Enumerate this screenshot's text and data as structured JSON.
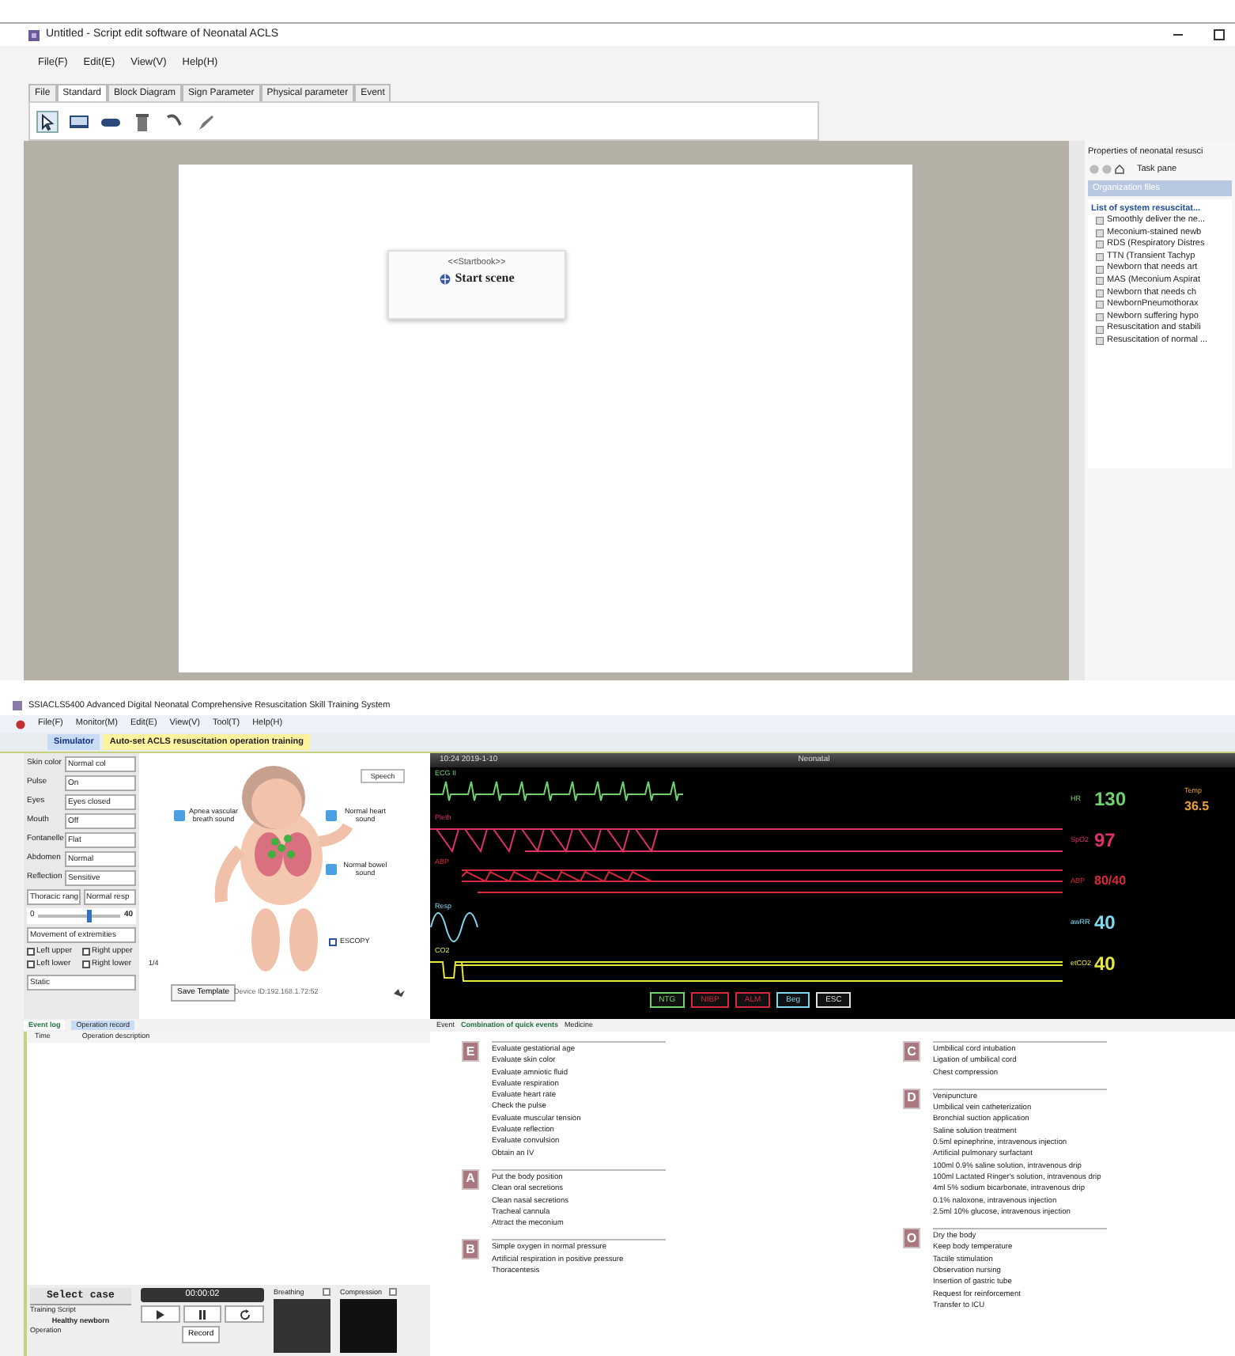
{
  "editor": {
    "title": "Untitled - Script edit software of Neonatal ACLS",
    "menu": [
      "File(F)",
      "Edit(E)",
      "View(V)",
      "Help(H)"
    ],
    "tabs": [
      {
        "label": "File",
        "selected": false
      },
      {
        "label": "Standard",
        "selected": true
      },
      {
        "label": "Block Diagram",
        "selected": false
      },
      {
        "label": "Sign Parameter",
        "selected": false
      },
      {
        "label": "Physical parameter",
        "selected": false
      },
      {
        "label": "Event",
        "selected": false
      }
    ],
    "start_node": {
      "stereotype": "<<Startbook>>",
      "label": "Start scene"
    },
    "properties": {
      "title": "Properties of neonatal resusci",
      "pane": "Task pane",
      "header": "Organization files",
      "root": "List of system resuscitat...",
      "items": [
        "Smoothly deliver the ne...",
        "Meconium-stained newb",
        "RDS (Respiratory Distres",
        "TTN (Transient Tachyp",
        "Newborn that needs art",
        "MAS (Meconium Aspirat",
        "Newborn that needs ch",
        "NewbornPneumothorax",
        "Newborn suffering hypo",
        "Resuscitation and stabili",
        "Resuscitation of normal ..."
      ]
    }
  },
  "trainer": {
    "title": "SSIACLS5400 Advanced Digital Neonatal Comprehensive Resuscitation Skill Training System",
    "menu": [
      "File(F)",
      "Monitor(M)",
      "Edit(E)",
      "View(V)",
      "Tool(T)",
      "Help(H)"
    ],
    "tabs": [
      {
        "label": "Simulator",
        "selected": true
      },
      {
        "label": "Auto-set ACLS resuscitation operation training",
        "selected": false
      }
    ],
    "params": [
      {
        "label": "Skin color",
        "value": "Normal col"
      },
      {
        "label": "Pulse",
        "value": "On"
      },
      {
        "label": "Eyes",
        "value": "Eyes closed"
      },
      {
        "label": "Mouth",
        "value": "Off"
      },
      {
        "label": "Fontanelle",
        "value": "Flat"
      },
      {
        "label": "Abdomen",
        "value": "Normal"
      },
      {
        "label": "Reflection",
        "value": "Sensitive"
      }
    ],
    "thoracic": {
      "label": "Thoracic rang",
      "value": "Normal resp",
      "min": "0",
      "max": "40",
      "level": 0.6
    },
    "movement": "Movement of extremities",
    "limbs": [
      {
        "label": "Left upper",
        "checked": false
      },
      {
        "label": "Right upper",
        "checked": false
      },
      {
        "label": "Left lower",
        "checked": false
      },
      {
        "label": "Right lower",
        "checked": false
      }
    ],
    "limb_state": "Static",
    "callouts": [
      "Speech",
      "Apnea vascular breath sound",
      "Normal heart sound",
      "Normal bowel sound"
    ],
    "escopy": {
      "label": "ESCOPY",
      "checked": false
    },
    "page": "1/4",
    "save_button": "Save Template",
    "device": "Device ID:192.168.1.72:52",
    "monitor": {
      "clock": "10:24 2019-1-10",
      "mode": "Neonatal",
      "waves": [
        {
          "kind": "ecg",
          "label": "ECG II",
          "color": "#6fd26f"
        },
        {
          "kind": "pleth",
          "label": "Pleth",
          "color": "#e0306a"
        },
        {
          "kind": "abp",
          "label": "ABP",
          "color": "#d8283c"
        },
        {
          "kind": "resp",
          "label": "Resp",
          "color": "#7fd8f0"
        },
        {
          "kind": "co2",
          "label": "CO2",
          "color": "#e6e640"
        }
      ],
      "vitals": [
        {
          "label": "HR",
          "value": "130",
          "color": "#6fd26f"
        },
        {
          "label": "SpO2",
          "value": "97",
          "color": "#e0306a"
        },
        {
          "label": "ABP",
          "value": "80/40",
          "color": "#d8283c"
        },
        {
          "label": "awRR",
          "value": "40",
          "color": "#7fd8f0"
        },
        {
          "label": "etCO2",
          "value": "40",
          "color": "#e6e640"
        }
      ],
      "temp": {
        "label": "Temp",
        "value": "36.5",
        "color": "#f0a030"
      },
      "buttons": [
        {
          "label": "NTG",
          "color": "#6fd26f"
        },
        {
          "label": "NIBP",
          "color": "#d8283c"
        },
        {
          "label": "ALM",
          "color": "#d8283c"
        },
        {
          "label": "Beg",
          "color": "#7fd8f0"
        },
        {
          "label": "ESC",
          "color": "#dddddd"
        }
      ]
    },
    "log_tabs": [
      {
        "label": "Event log",
        "selected": true
      },
      {
        "label": "Operation record",
        "selected": false
      }
    ],
    "log_columns": [
      "Time",
      "Operation description"
    ],
    "case": {
      "title": "Select case",
      "script_label": "Training Script",
      "script": "Healthy newborn",
      "operation_label": "Operation",
      "timer": "00:00:02",
      "record": "Record",
      "breathing": "Breathing",
      "compression": "Compression"
    },
    "event_tabs": [
      {
        "label": "Event",
        "selected": false
      },
      {
        "label": "Combination of quick events",
        "selected": true
      },
      {
        "label": "Medicine",
        "selected": false
      }
    ],
    "event_columns": [
      [
        {
          "letter": "E",
          "items": [
            "Evaluate gestational age",
            "Evaluate skin color",
            "Evaluate amniotic fluid",
            "Evaluate respiration",
            "Evaluate heart rate",
            "Check the pulse",
            "Evaluate muscular tension",
            "Evaluate reflection",
            "Evaluate convulsion",
            "Obtain an IV"
          ]
        },
        {
          "letter": "A",
          "items": [
            "Put the body position",
            "Clean oral secretions",
            "Clean nasal secretions",
            "Tracheal cannula",
            "Attract the meconium"
          ]
        },
        {
          "letter": "B",
          "items": [
            "Simple oxygen in normal pressure",
            "Artificial respiration in positive pressure",
            "Thoracentesis"
          ]
        }
      ],
      [
        {
          "letter": "C",
          "items": [
            "Umbilical cord intubation",
            "Ligation of umbilical cord",
            "Chest compression"
          ]
        },
        {
          "letter": "D",
          "items": [
            "Venipuncture",
            "Umbilical vein catheterization",
            "Bronchial suction application",
            "Saline solution treatment",
            "0.5ml epinephrine, intravenous injection",
            "Artificial pulmonary surfactant",
            "100ml 0.9% saline solution, intravenous drip",
            "100ml Lactated Ringer's solution, intravenous drip",
            "4ml 5% sodium bicarbonate, intravenous drip",
            "0.1% naloxone, intravenous injection",
            "2.5ml 10% glucose, intravenous injection"
          ]
        },
        {
          "letter": "O",
          "items": [
            "Dry the body",
            "Keep body temperature",
            "Tactile stimulation",
            "Observation nursing",
            "Insertion of gastric tube",
            "Request for reinforcement",
            "Transfer to ICU"
          ]
        }
      ]
    ]
  }
}
